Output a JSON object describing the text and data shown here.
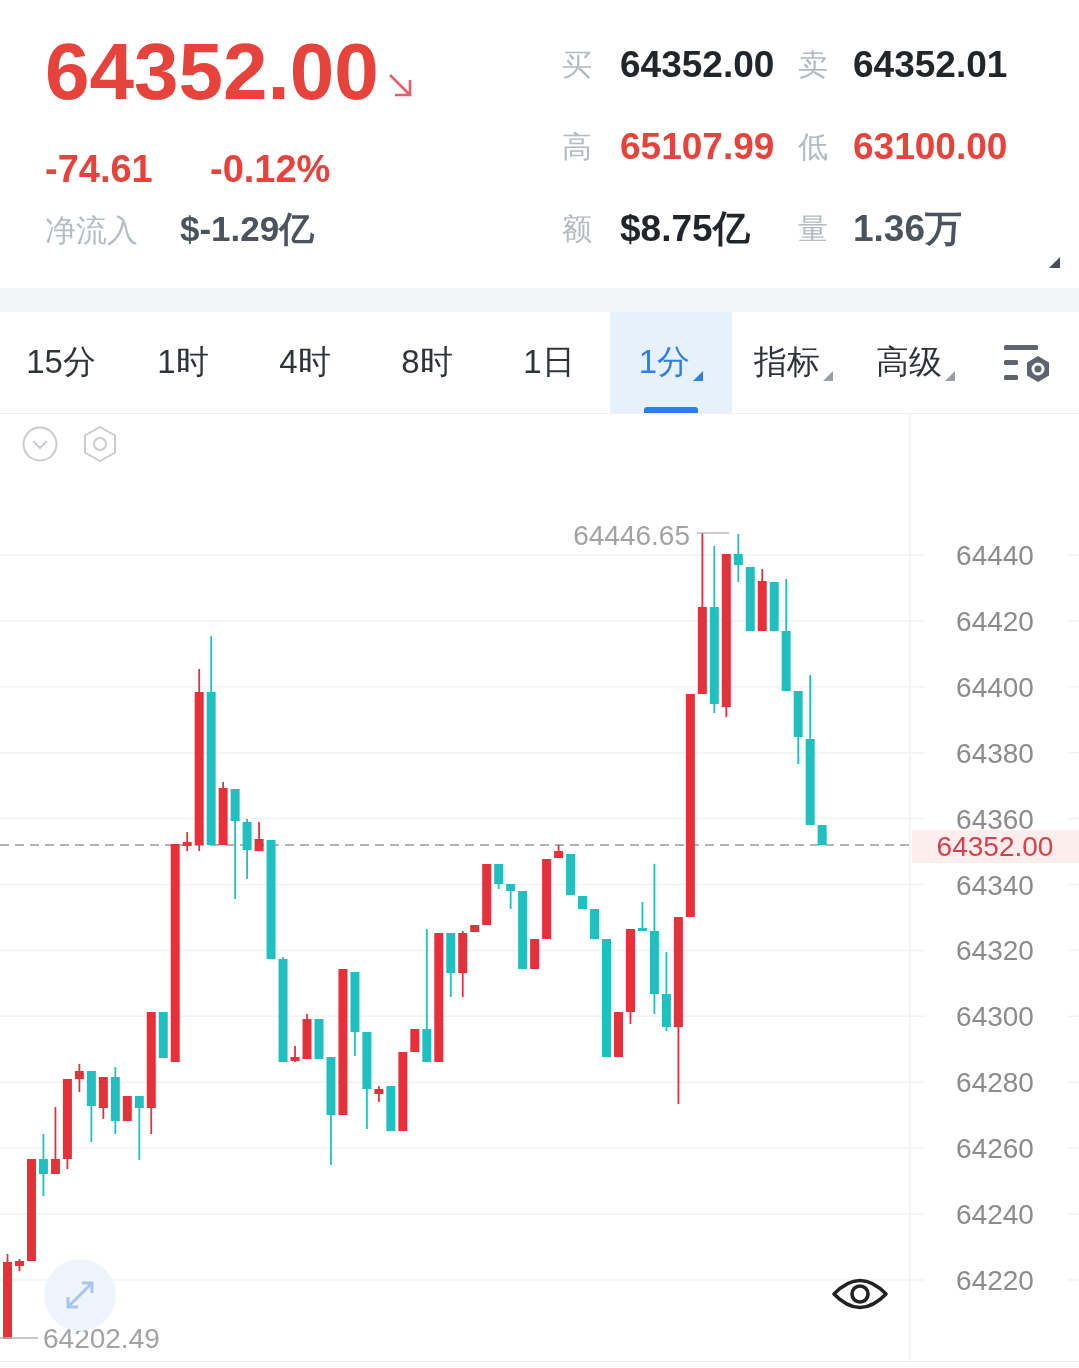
{
  "quote": {
    "price": "64352.00",
    "falling": true,
    "change": "-74.61",
    "change_percent": "-0.12%",
    "net_inflow_label": "净流入",
    "net_inflow": "$-1.29亿"
  },
  "stats": [
    {
      "label": "买",
      "value": "64352.00",
      "kind": "plain"
    },
    {
      "label": "卖",
      "value": "64352.01",
      "kind": "plain"
    },
    {
      "label": "高",
      "value": "65107.99",
      "kind": "accent"
    },
    {
      "label": "低",
      "value": "63100.00",
      "kind": "accent"
    },
    {
      "label": "额",
      "value": "$8.75亿",
      "kind": "plain"
    },
    {
      "label": "量",
      "value": "1.36万",
      "kind": "muted"
    }
  ],
  "tabs": [
    {
      "label": "15分",
      "selected": false,
      "dropdown": false
    },
    {
      "label": "1时",
      "selected": false,
      "dropdown": false
    },
    {
      "label": "4时",
      "selected": false,
      "dropdown": false
    },
    {
      "label": "8时",
      "selected": false,
      "dropdown": false
    },
    {
      "label": "1日",
      "selected": false,
      "dropdown": false
    },
    {
      "label": "1分",
      "selected": true,
      "dropdown": true
    },
    {
      "label": "指标",
      "selected": false,
      "dropdown": true
    },
    {
      "label": "高级",
      "selected": false,
      "dropdown": true
    }
  ],
  "chart": {
    "price_axis_labels": [
      "64440",
      "64420",
      "64400",
      "64380",
      "64360",
      "64340",
      "64320",
      "64300",
      "64280",
      "64260",
      "64240",
      "64220"
    ],
    "current_price": "64352.00",
    "high_label": "64446.65",
    "low_label": "64202.49"
  }
}
